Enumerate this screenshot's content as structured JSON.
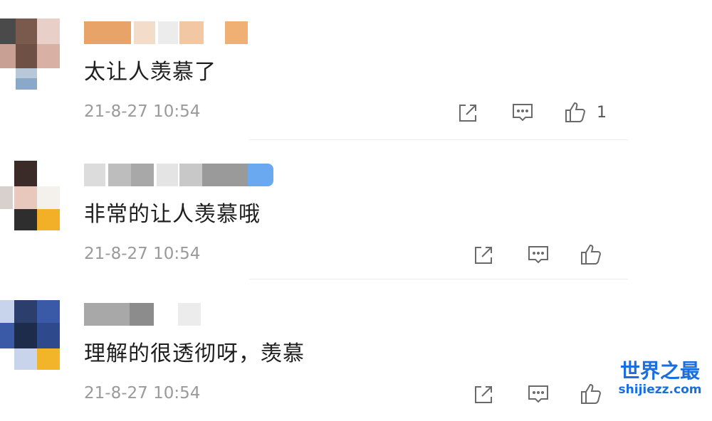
{
  "comments": [
    {
      "text": "太让人羡慕了",
      "time": "21-8-27 10:54",
      "like_count": "1",
      "avatar_colors": [
        "#4a4a4a",
        "#7a5a4c",
        "#e8d0c8",
        "#c8a094",
        "#6e5044",
        "#d8b0a4",
        "#b8c8d8",
        "#8aa8c8"
      ],
      "name_colors": [
        "#e8a468",
        "#f4dccb",
        "#ececec",
        "#f2c8a4",
        "#f0b074"
      ]
    },
    {
      "text": "非常的让人羡慕哦",
      "time": "21-8-27 10:54",
      "like_count": "",
      "avatar_colors": [
        "#3a2a28",
        "#d8d0cc",
        "#e8c8bc",
        "#2e2e2e",
        "#f2b028",
        "#f4f0ec"
      ],
      "name_colors": [
        "#dcdcdc",
        "#bdbdbd",
        "#a8a8a8",
        "#e4e4e4",
        "#c8c8c8",
        "#9a9a9a",
        "#6aa8f0"
      ]
    },
    {
      "text": "理解的很透彻呀，羡慕",
      "time": "21-8-27 10:54",
      "like_count": "",
      "avatar_colors": [
        "#2c3e6c",
        "#3a5aa8",
        "#1e2c4c",
        "#2e4a8c",
        "#c8d4ec",
        "#f2b428"
      ],
      "name_colors": [
        "#a8a8a8",
        "#8c8c8c",
        "#ececec"
      ]
    }
  ],
  "icons": {
    "share": "share-icon",
    "reply": "comment-icon",
    "like": "thumbs-up-icon"
  },
  "watermark": {
    "title": "世界之最",
    "subtitle": "shijiezz.com"
  }
}
